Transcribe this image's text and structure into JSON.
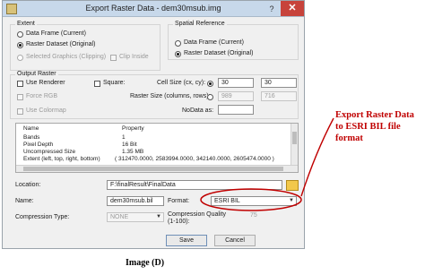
{
  "window": {
    "title": "Export Raster Data - dem30msub.img",
    "help_label": "?",
    "close_label": "✕"
  },
  "extent": {
    "label": "Extent",
    "options": [
      "Data Frame (Current)",
      "Raster Dataset (Original)",
      "Selected Graphics (Clipping)"
    ],
    "selected": "Raster Dataset (Original)",
    "clip_inside_label": "Clip Inside"
  },
  "spatial_reference": {
    "label": "Spatial Reference",
    "options": [
      "Data Frame (Current)",
      "Raster Dataset (Original)"
    ],
    "selected": "Raster Dataset (Original)"
  },
  "output_raster": {
    "label": "Output Raster",
    "use_renderer_label": "Use Renderer",
    "force_rgb_label": "Force RGB",
    "use_colormap_label": "Use Colormap",
    "square_label": "Square:",
    "cell_size_label": "Cell Size (cx, cy):",
    "cell_size_x": "30",
    "cell_size_y": "30",
    "raster_size_label": "Raster Size (columns, rows):",
    "raster_columns": "989",
    "raster_rows": "716",
    "nodata_label": "NoData as:",
    "nodata_value": ""
  },
  "properties": {
    "header": [
      "Name",
      "Property"
    ],
    "rows": [
      [
        "Bands",
        "1"
      ],
      [
        "Pixel Depth",
        "16 Bit"
      ],
      [
        "Uncompressed Size",
        "1.35 MB"
      ],
      [
        "Extent (left, top, right, bottom)",
        "( 312470.0000, 2583994.0000, 342140.0000, 2605474.0000 )"
      ]
    ]
  },
  "output": {
    "location_label": "Location:",
    "location_value": "F:\\finalResult\\FinalData",
    "name_label": "Name:",
    "name_value": "dem30msub.bil",
    "format_label": "Format:",
    "format_value": "ESRI BIL",
    "compression_type_label": "Compression Type:",
    "compression_type_value": "NONE",
    "compression_quality_label": "Compression Quality",
    "compression_quality_range": "(1-100):",
    "compression_quality_value": "75"
  },
  "buttons": {
    "save_label": "Save",
    "cancel_label": "Cancel"
  },
  "annotation": {
    "lines": [
      "Export Raster Data",
      "to ESRI BIL file",
      "format"
    ],
    "color": "#c00000"
  },
  "caption": "Image (D)",
  "colors": {
    "titlebar": "#c7d8ea",
    "close_button": "#c7433b",
    "dialog_bg": "#f0f0f0"
  }
}
